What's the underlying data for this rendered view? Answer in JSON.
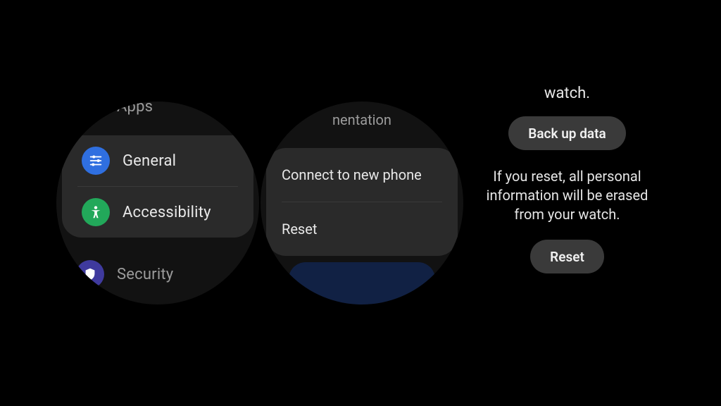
{
  "watch1": {
    "top_item": "Apps",
    "card_items": [
      "General",
      "Accessibility"
    ],
    "bottom_item": "Security"
  },
  "watch2": {
    "top_fragment": "nentation",
    "card_items": [
      "Connect to new phone",
      "Reset"
    ]
  },
  "watch3": {
    "top_fragment": "watch.",
    "backup_button": "Back up data",
    "body_text": "If you reset, all personal information will be erased from your watch.",
    "reset_button": "Reset"
  }
}
